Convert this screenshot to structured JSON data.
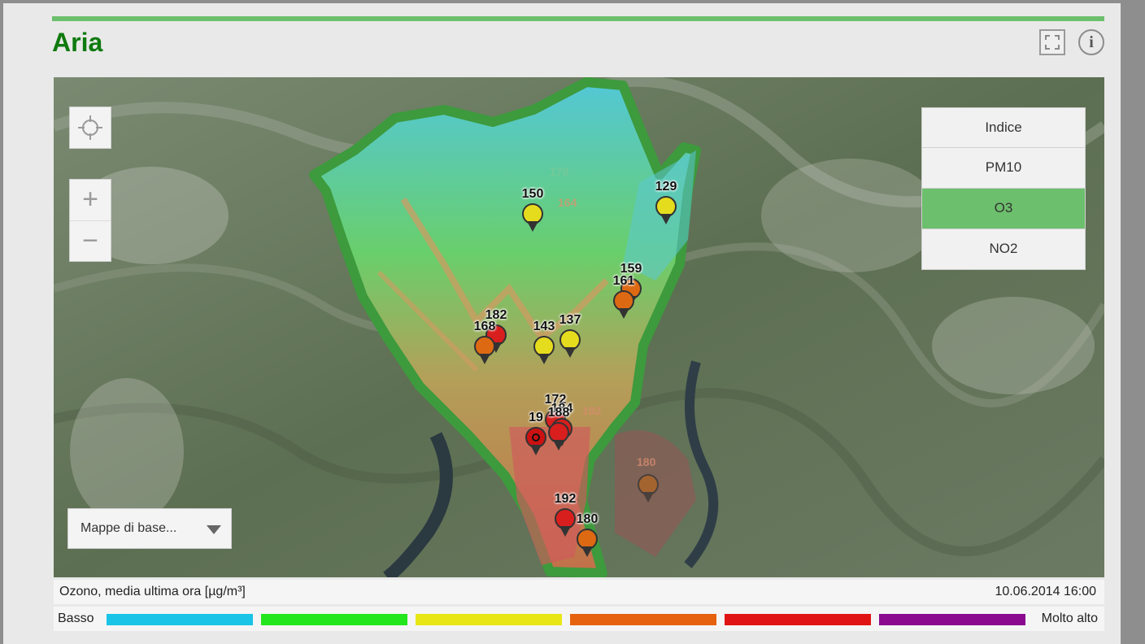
{
  "title": "Aria",
  "header": {
    "fullscreen_icon": "fullscreen-icon",
    "info_glyph": "i"
  },
  "map_controls": {
    "locate_icon": "crosshair-icon",
    "zoom_in": "+",
    "zoom_out": "−"
  },
  "layers": [
    {
      "label": "Indice",
      "active": false
    },
    {
      "label": "PM10",
      "active": false
    },
    {
      "label": "O3",
      "active": true
    },
    {
      "label": "NO2",
      "active": false
    }
  ],
  "basemap_select": {
    "label": "Mappe di base...",
    "icon": "chevron-down-icon"
  },
  "stations": [
    {
      "value": "150",
      "color": "#e6dc1e"
    },
    {
      "value": "129",
      "color": "#e6dc1e"
    },
    {
      "value": "159",
      "color": "#dd6a12"
    },
    {
      "value": "161",
      "color": "#dd6a12"
    },
    {
      "value": "182",
      "color": "#d91e1e"
    },
    {
      "value": "168",
      "color": "#dd6a12"
    },
    {
      "value": "143",
      "color": "#e6dc1e"
    },
    {
      "value": "137",
      "color": "#e6dc1e"
    },
    {
      "value": "172",
      "color": "#d91e1e"
    },
    {
      "value": "184",
      "color": "#d91e1e"
    },
    {
      "value": "188",
      "color": "#d91e1e"
    },
    {
      "value": "19",
      "color": "#cc1111"
    },
    {
      "value": "192",
      "color": "#d91e1e"
    },
    {
      "value": "180",
      "color": "#dd6a12"
    }
  ],
  "faded_labels": [
    "178",
    "164",
    "192",
    "180"
  ],
  "caption": "Ozono, media ultima ora [µg/m³]",
  "timestamp": "10.06.2014 16:00",
  "legend": {
    "low": "Basso",
    "high": "Molto alto",
    "colors": [
      "#19c4e6",
      "#23e61d",
      "#e9e616",
      "#e7620f",
      "#e01414",
      "#8a098f"
    ]
  }
}
